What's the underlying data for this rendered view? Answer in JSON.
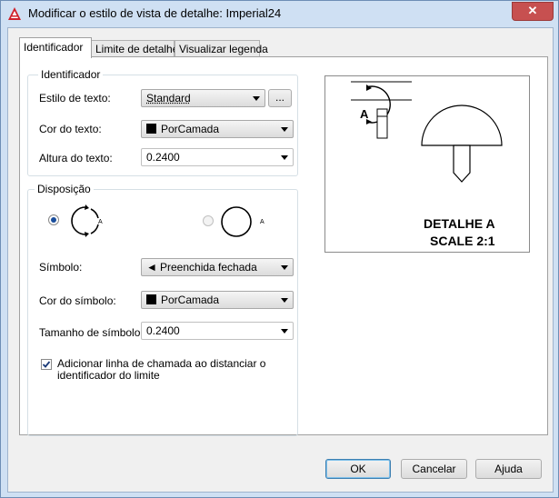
{
  "window": {
    "title": "Modificar o estilo de vista de detalhe: Imperial24",
    "close_label": "✕"
  },
  "tabs": [
    {
      "label": "Identificador",
      "active": true
    },
    {
      "label": "Limite de detalhe",
      "active": false
    },
    {
      "label": "Visualizar legenda",
      "active": false
    }
  ],
  "identifier_group": {
    "legend": "Identificador",
    "text_style_label": "Estilo de texto:",
    "text_style_value": "Standard",
    "browse_label": "...",
    "text_color_label": "Cor do texto:",
    "text_color_value": "PorCamada",
    "text_height_label": "Altura do texto:",
    "text_height_value": "0.2400"
  },
  "layout_group": {
    "legend": "Disposição",
    "option_label": "A",
    "symbol_label": "Símbolo:",
    "symbol_value": "Preenchida fechada",
    "symbol_color_label": "Cor do símbolo:",
    "symbol_color_value": "PorCamada",
    "symbol_size_label": "Tamanho de símbolo:",
    "symbol_size_value": "0.2400",
    "checkbox_label_line1": "Adicionar linha de chamada ao distanciar o",
    "checkbox_label_line2": "identificador do limite",
    "checkbox_checked": true
  },
  "preview": {
    "detail_letter": "A",
    "caption_line1": "DETALHE A",
    "caption_line2": "SCALE 2:1"
  },
  "footer": {
    "ok_label": "OK",
    "cancel_label": "Cancelar",
    "help_label": "Ajuda"
  },
  "colors": {
    "title_bar": "#cfe0f3",
    "close_button": "#c75050",
    "radio_selected": "#1a4e9c"
  }
}
